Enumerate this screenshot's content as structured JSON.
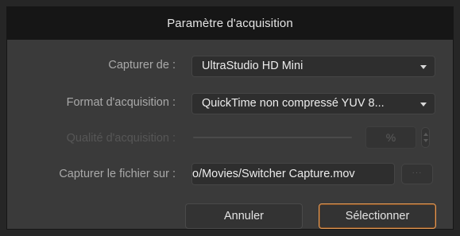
{
  "dialog": {
    "title": "Paramètre d'acquisition"
  },
  "form": {
    "capture_from": {
      "label": "Capturer de :",
      "value": "UltraStudio HD Mini"
    },
    "format": {
      "label": "Format d'acquisition :",
      "value": "QuickTime non compressé YUV 8..."
    },
    "quality": {
      "label": "Qualité d'acquisition :",
      "unit": "%",
      "disabled": true
    },
    "capture_file": {
      "label": "Capturer le fichier sur :",
      "value": "o/Movies/Switcher Capture.mov",
      "browse_label": "···"
    }
  },
  "buttons": {
    "cancel": "Annuler",
    "select": "Sélectionner"
  },
  "colors": {
    "dialog_bg": "#3a3a3a",
    "titlebar_bg": "#161616",
    "accent": "#e29a57"
  }
}
